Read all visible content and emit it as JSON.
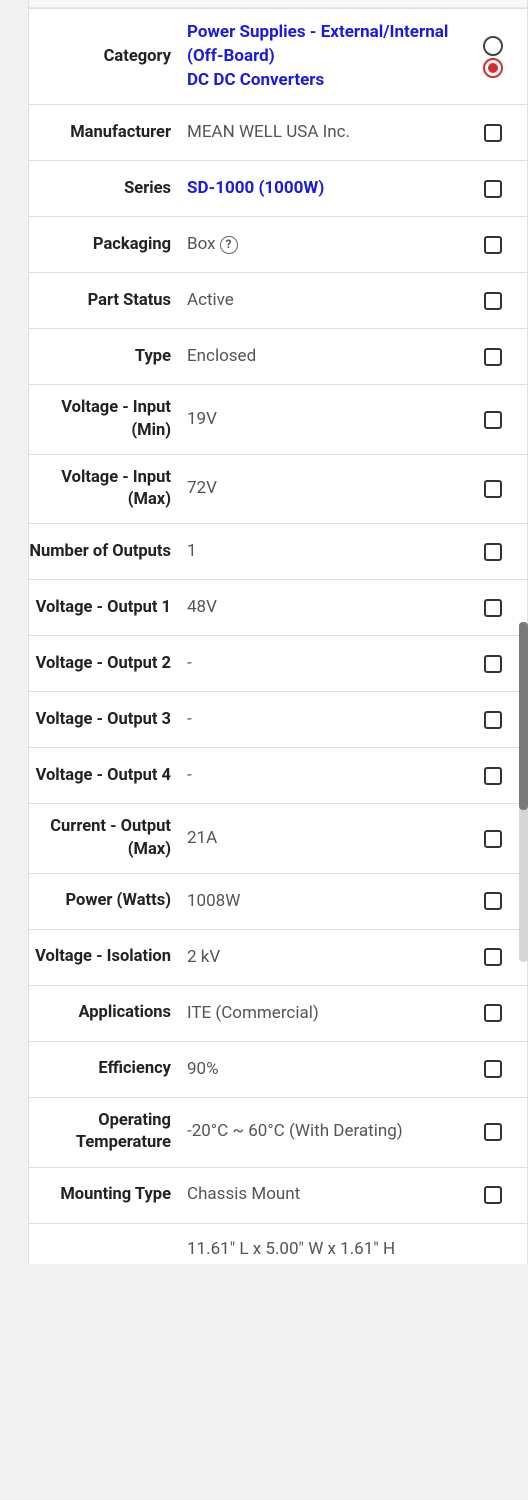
{
  "rows": [
    {
      "label": "Category",
      "value_lines": [
        "Power Supplies - External/Internal (Off-Board)",
        "DC DC Converters"
      ],
      "link": true,
      "control": "radio-pair"
    },
    {
      "label": "Manufacturer",
      "value": "MEAN WELL USA Inc.",
      "control": "checkbox"
    },
    {
      "label": "Series",
      "value": "SD-1000 (1000W)",
      "link": true,
      "control": "checkbox"
    },
    {
      "label": "Packaging",
      "value": "Box",
      "help": true,
      "control": "checkbox"
    },
    {
      "label": "Part Status",
      "value": "Active",
      "control": "checkbox"
    },
    {
      "label": "Type",
      "value": "Enclosed",
      "control": "checkbox"
    },
    {
      "label": "Voltage - Input (Min)",
      "value": "19V",
      "control": "checkbox"
    },
    {
      "label": "Voltage - Input (Max)",
      "value": "72V",
      "control": "checkbox"
    },
    {
      "label": "Number of Outputs",
      "value": "1",
      "control": "checkbox"
    },
    {
      "label": "Voltage - Output 1",
      "value": "48V",
      "control": "checkbox"
    },
    {
      "label": "Voltage - Output 2",
      "value": "-",
      "control": "checkbox"
    },
    {
      "label": "Voltage - Output 3",
      "value": "-",
      "control": "checkbox"
    },
    {
      "label": "Voltage - Output 4",
      "value": "-",
      "control": "checkbox"
    },
    {
      "label": "Current - Output (Max)",
      "value": "21A",
      "control": "checkbox"
    },
    {
      "label": "Power (Watts)",
      "value": "1008W",
      "control": "checkbox"
    },
    {
      "label": "Voltage - Isolation",
      "value": "2 kV",
      "control": "checkbox"
    },
    {
      "label": "Applications",
      "value": "ITE (Commercial)",
      "control": "checkbox"
    },
    {
      "label": "Efficiency",
      "value": "90%",
      "control": "checkbox"
    },
    {
      "label": "Operating Temperature",
      "value": "-20°C ~ 60°C (With Derating)",
      "control": "checkbox"
    },
    {
      "label": "Mounting Type",
      "value": "Chassis Mount",
      "control": "checkbox"
    },
    {
      "label": "",
      "value": "11.61\" L x 5.00\" W x 1.61\" H",
      "control": "none",
      "partial": true
    }
  ]
}
